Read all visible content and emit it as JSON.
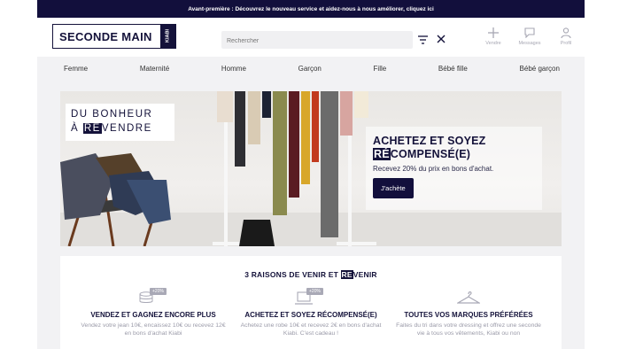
{
  "announcement": "Avant-première : Découvrez le nouveau service et aidez-nous à nous améliorer, cliquez ici",
  "header": {
    "logo_text": "SECONDE MAIN",
    "logo_brand": "KIABI",
    "search_placeholder": "Rechercher",
    "actions": [
      {
        "label": "Vendre",
        "icon": "plus-icon"
      },
      {
        "label": "Messages",
        "icon": "message-icon"
      },
      {
        "label": "Profil",
        "icon": "user-icon"
      }
    ]
  },
  "nav": [
    "Femme",
    "Maternité",
    "Homme",
    "Garçon",
    "Fille",
    "Bébé fille",
    "Bébé garçon"
  ],
  "hero": {
    "tagline_line1": "DU BONHEUR",
    "tagline_line2_pre": "À ",
    "tagline_line2_re": "RE",
    "tagline_line2_post": "VENDRE",
    "promo_title_line1": "ACHETEZ ET SOYEZ",
    "promo_title_re": "RÉ",
    "promo_title_line2": "COMPENSÉ(E)",
    "promo_subtitle": "Recevez 20% du prix en bons d'achat.",
    "promo_button": "J'achète"
  },
  "reasons": {
    "title_pre": "3 RAISONS DE VENIR ET ",
    "title_re": "RE",
    "title_post": "VENIR",
    "items": [
      {
        "badge": "+20%",
        "title": "VENDEZ ET GAGNEZ ENCORE PLUS",
        "text": "Vendez votre jean 10€, encaissez 10€ ou recevez 12€ en bons d'achat Kiabi"
      },
      {
        "badge": "+20%",
        "title": "ACHETEZ ET SOYEZ RÉCOMPENSÉ(E)",
        "text": "Achetez une robe 10€ et recevez 2€ en bons d'achat Kiabi. C'est cadeau !"
      },
      {
        "badge": "",
        "title": "TOUTES VOS MARQUES PRÉFÉRÉES",
        "text": "Faites du tri dans votre dressing et offrez une seconde vie à tous vos vêtements, Kiabi ou non"
      }
    ]
  },
  "colors": {
    "navy": "#120f3c",
    "nav_bg": "#f2f2f4",
    "muted": "#a7a7b3"
  }
}
